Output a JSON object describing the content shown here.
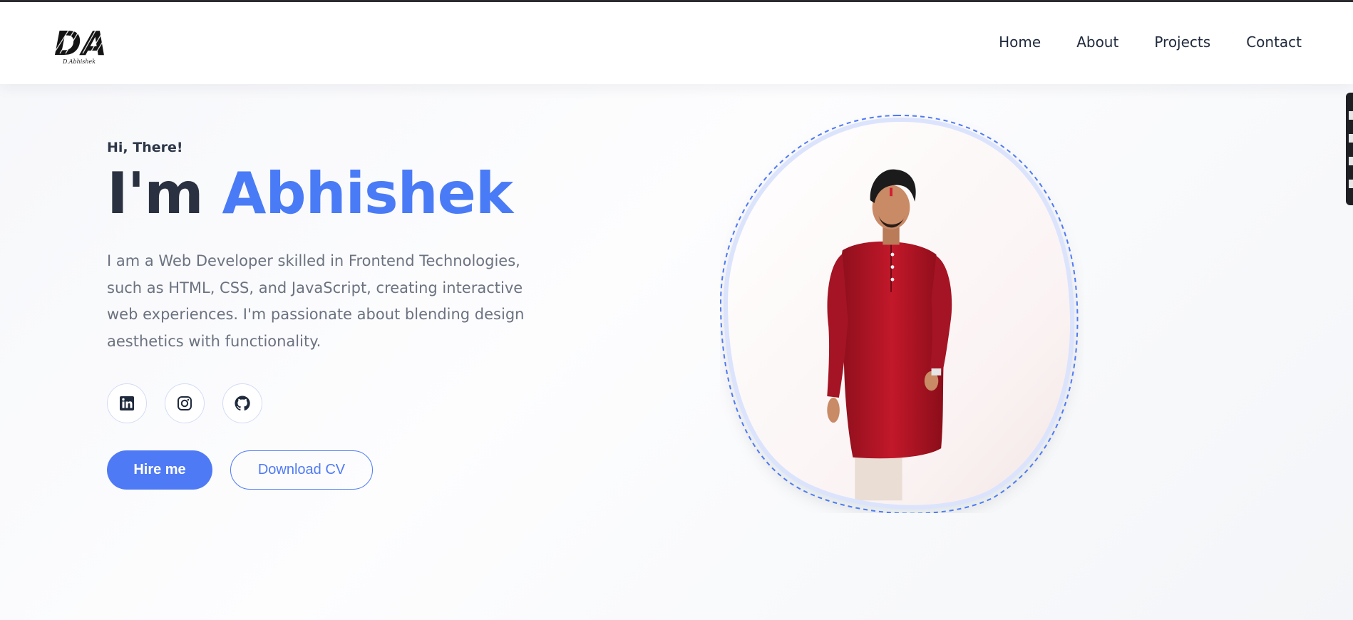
{
  "nav": {
    "logo_text": "DA",
    "logo_subtext": "D.Abhishek",
    "links": [
      "Home",
      "About",
      "Projects",
      "Contact"
    ]
  },
  "hero": {
    "greeting": "Hi, There!",
    "headline_prefix": "I'm",
    "headline_name": "Abhishek",
    "description": "I am a Web Developer skilled in Frontend Technologies, such as HTML, CSS, and JavaScript, creating interactive web experiences. I'm passionate about blending design aesthetics with functionality.",
    "socials": [
      "linkedin-icon",
      "instagram-icon",
      "github-icon"
    ],
    "primary_button": "Hire me",
    "secondary_button": "Download CV"
  },
  "colors": {
    "accent": "#4f7af5",
    "heading": "#2a3242",
    "text": "#6b7280"
  }
}
